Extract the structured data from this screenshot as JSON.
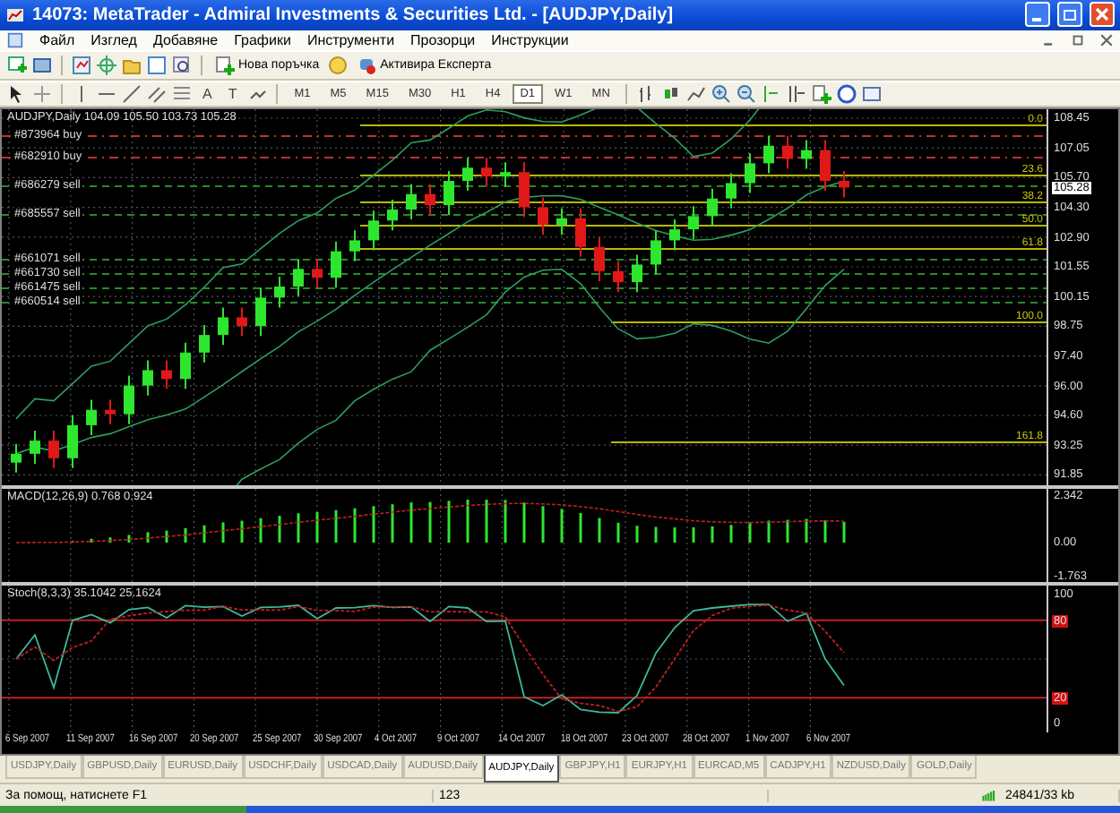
{
  "window": {
    "title": "14073: MetaTrader - Admiral Investments & Securities Ltd. - [AUDJPY,Daily]"
  },
  "menu": [
    "Файл",
    "Изглед",
    "Добавяне",
    "Графики",
    "Инструменти",
    "Прозорци",
    "Инструкции"
  ],
  "toolbar": {
    "buttons": [
      "Нова поръчка",
      "Активира Експерта"
    ]
  },
  "text_tools": [
    "A",
    "T"
  ],
  "timeframes": [
    {
      "label": "M1",
      "selected": false
    },
    {
      "label": "M5",
      "selected": false
    },
    {
      "label": "M15",
      "selected": false
    },
    {
      "label": "M30",
      "selected": false
    },
    {
      "label": "H1",
      "selected": false
    },
    {
      "label": "H4",
      "selected": false
    },
    {
      "label": "D1",
      "selected": true
    },
    {
      "label": "W1",
      "selected": false
    },
    {
      "label": "MN",
      "selected": false
    }
  ],
  "chart": {
    "legend": "AUDJPY,Daily  104.09 105.50 103.73 105.28",
    "current_price": "105.28",
    "price_axis": [
      "108.45",
      "107.05",
      "105.70",
      "104.30",
      "102.90",
      "101.55",
      "100.15",
      "98.75",
      "97.40",
      "96.00",
      "94.60",
      "93.25",
      "91.85"
    ],
    "orders": [
      {
        "label": "#873964 buy",
        "kind": "buy"
      },
      {
        "label": "#682910 buy",
        "kind": "buy"
      },
      {
        "label": "#686279 sell",
        "kind": "sell"
      },
      {
        "label": "#685557 sell",
        "kind": "sell"
      },
      {
        "label": "#661071 sell",
        "kind": "sell"
      },
      {
        "label": "#661730 sell",
        "kind": "sell"
      },
      {
        "label": "#661475 sell",
        "kind": "sell"
      },
      {
        "label": "#660514 sell",
        "kind": "sell"
      }
    ],
    "fib_levels": [
      "0.0",
      "23.6",
      "38.2",
      "50.0",
      "61.8",
      "100.0",
      "161.8"
    ]
  },
  "macd": {
    "legend": "MACD(12,26,9) 0.768 0.924",
    "axis": [
      "2.342",
      "0.00",
      "-1.763"
    ]
  },
  "stochastic": {
    "legend": "Stoch(8,3,3) 35.1042 25.1624",
    "axis": [
      "100",
      "80",
      "20",
      "0"
    ]
  },
  "dates": [
    "6 Sep 2007",
    "11 Sep 2007",
    "16 Sep 2007",
    "20 Sep 2007",
    "25 Sep 2007",
    "30 Sep 2007",
    "4 Oct 2007",
    "9 Oct 2007",
    "14 Oct 2007",
    "18 Oct 2007",
    "23 Oct 2007",
    "28 Oct 2007",
    "1 Nov 2007",
    "6 Nov 2007"
  ],
  "tabs": [
    {
      "label": "USDJPY,Daily",
      "selected": false
    },
    {
      "label": "GBPUSD,Daily",
      "selected": false
    },
    {
      "label": "EURUSD,Daily",
      "selected": false
    },
    {
      "label": "USDCHF,Daily",
      "selected": false
    },
    {
      "label": "USDCAD,Daily",
      "selected": false
    },
    {
      "label": "AUDUSD,Daily",
      "selected": false
    },
    {
      "label": "AUDJPY,Daily",
      "selected": true
    },
    {
      "label": "GBPJPY,H1",
      "selected": false
    },
    {
      "label": "EURJPY,H1",
      "selected": false
    },
    {
      "label": "EURCAD,M5",
      "selected": false
    },
    {
      "label": "CADJPY,H1",
      "selected": false
    },
    {
      "label": "NZDUSD,Daily",
      "selected": false
    },
    {
      "label": "GOLD,Daily",
      "selected": false
    }
  ],
  "status_bar": {
    "help": "За помощ, натиснете F1",
    "profile": "123",
    "traffic": "24841/33 kb"
  }
}
